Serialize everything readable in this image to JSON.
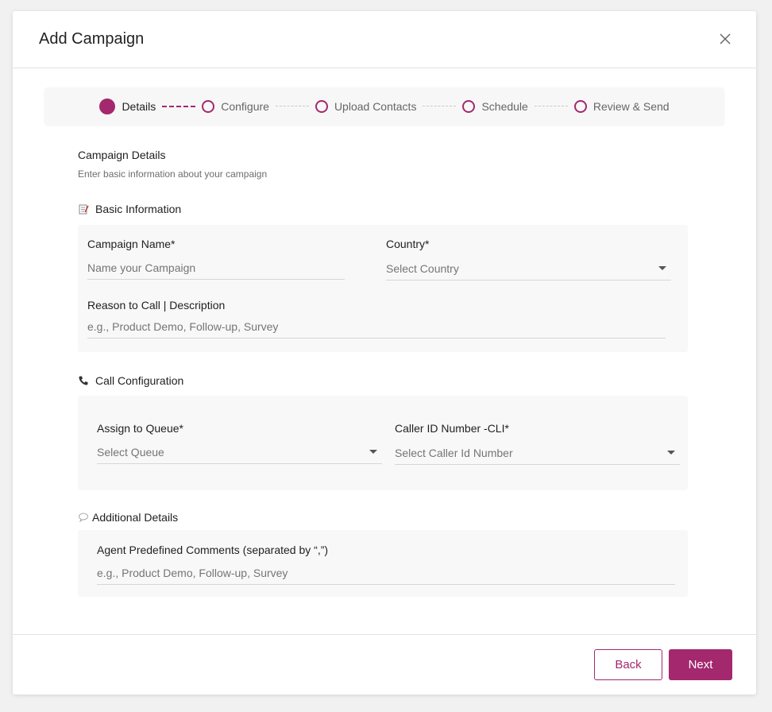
{
  "modal": {
    "title": "Add Campaign"
  },
  "stepper": {
    "steps": [
      {
        "label": "Details",
        "state": "active"
      },
      {
        "label": "Configure",
        "state": "pending"
      },
      {
        "label": "Upload Contacts",
        "state": "pending"
      },
      {
        "label": "Schedule",
        "state": "pending"
      },
      {
        "label": "Review & Send",
        "state": "pending"
      }
    ]
  },
  "section": {
    "title": "Campaign Details",
    "subtitle": "Enter basic information about your campaign"
  },
  "basic_info": {
    "heading": "Basic Information",
    "campaign_name": {
      "label": "Campaign Name*",
      "placeholder": "Name your Campaign",
      "value": ""
    },
    "country": {
      "label": "Country*",
      "placeholder": "Select Country"
    },
    "reason": {
      "label": "Reason to Call | Description",
      "placeholder": "e.g., Product Demo, Follow-up, Survey",
      "value": ""
    }
  },
  "call_config": {
    "heading": "Call Configuration",
    "queue": {
      "label": "Assign to Queue*",
      "placeholder": "Select Queue"
    },
    "caller_id": {
      "label": "Caller ID Number -CLI*",
      "placeholder": "Select Caller Id Number"
    }
  },
  "additional": {
    "heading": "Additional Details",
    "comments": {
      "label": "Agent Predefined Comments (separated by “,”)",
      "placeholder": "e.g., Product Demo, Follow-up, Survey",
      "value": ""
    }
  },
  "footer": {
    "back_label": "Back",
    "next_label": "Next"
  },
  "colors": {
    "accent": "#a3286e",
    "panel_bg": "#f8f8f8",
    "page_bg": "#f1f1f1"
  },
  "icons": {
    "close": "close-icon",
    "basic_info": "memo-icon",
    "call_config": "phone-icon",
    "additional": "speech-bubble-icon",
    "dropdown": "chevron-down-icon"
  }
}
